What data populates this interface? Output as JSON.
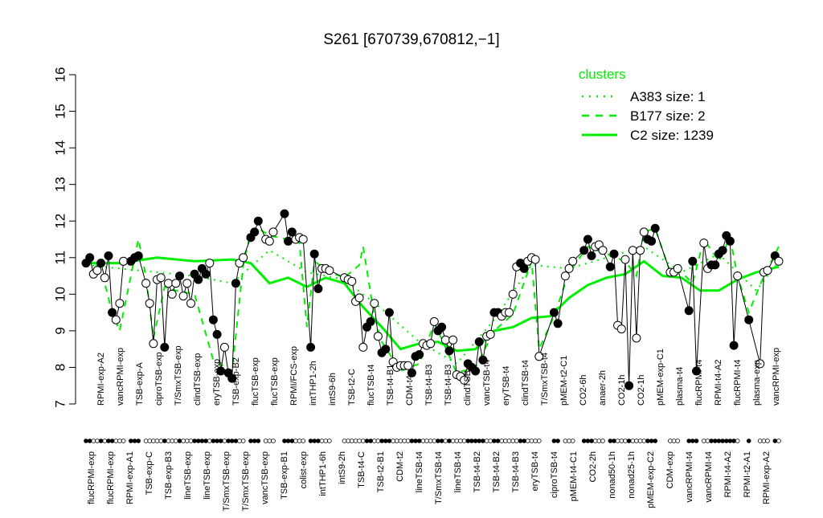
{
  "chart_data": {
    "type": "line",
    "title": "S261 [670739,670812,−1]",
    "xlabel": "",
    "ylabel": "",
    "ylim": [
      7,
      16
    ],
    "y_ticks": [
      "7",
      "8",
      "9",
      "10",
      "11",
      "12",
      "13",
      "14",
      "15",
      "16"
    ],
    "grid": false,
    "legend": {
      "title": "clusters",
      "placement": "top-right",
      "color": "#00ee00",
      "entries": [
        {
          "label": "A383 size: 1",
          "style": "dotted"
        },
        {
          "label": "B177 size: 2",
          "style": "dashed"
        },
        {
          "label": "C2 size: 1239",
          "style": "solid"
        }
      ]
    },
    "x_tick_labels": [
      "flucRPMI-exp",
      "RPMI-exp-A2",
      "flucRPMI-exp",
      "vancRPMI-exp",
      "RPMI-exp-A1",
      "TSB-exp-A",
      "TSB-exp-C",
      "ciproTSB-exp",
      "TSB-exp-B3",
      "T/SmxTSB-exp",
      "lineTSB-exp",
      "clindTSB-exp",
      "lineTSB-exp",
      "eryTSB-exp",
      "T/SmxTSB-exp",
      "TSB-exp-B2",
      "T/SmxTSB-exp",
      "flucTSB-exp",
      "vancTSB-exp",
      "flucTSB-exp",
      "TSB-exp-B1",
      "RPMI/FCS-exp",
      "colist-exp",
      "intTHP1-2h",
      "intTHP1-6h",
      "intS9-6h",
      "intS9-2h",
      "TSB-t2-C",
      "TSB-t4-C",
      "flucTSB-t4",
      "TSB-t2-B1",
      "TSB-t4-B1",
      "CDM-t2",
      "CDM-t4",
      "lineTSB-t4",
      "TSB-t4-B3",
      "T/SmxTSB-t4",
      "TSB-t4-B3",
      "lineTSB-t4",
      "clindTSB-t4",
      "TSB-t4-B2",
      "vancTSB-t4",
      "TSB-t4-B2",
      "eryTSB-t4",
      "TSB-t4-B3",
      "clindTSB-t4",
      "eryTSB-t4",
      "T/SmxTSB-t4",
      "ciproTSB-t4",
      "pMEM-t2-C1",
      "pMEM-t4-C1",
      "CO2-6h",
      "CO2-2h",
      "anaer-2h",
      "nonad50-1h",
      "CO2-1h",
      "nonad25-1h",
      "CO2-1h",
      "pMEM-exp-C2",
      "pMEM-exp-C1",
      "CDM-exp",
      "plasma-t4",
      "vancRPMI-t4",
      "flucRPMI-t4",
      "vancRPMI-t4",
      "RPMI-t4-A2",
      "RPMI-t4-A2",
      "flucRPMI-t4",
      "RPMI-t2-A1",
      "plasma-exp",
      "RPMI-exp-A2",
      "vancRPMI-exp"
    ],
    "series": [
      {
        "name": "",
        "style": "points-black-line",
        "points": [
          [
            1,
            10.85
          ],
          [
            2,
            11.0
          ],
          [
            3,
            10.55
          ],
          [
            4,
            10.65
          ],
          [
            5,
            10.85
          ],
          [
            6,
            10.45
          ],
          [
            7,
            11.05
          ],
          [
            8,
            9.5
          ],
          [
            9,
            9.3
          ],
          [
            10,
            9.75
          ],
          [
            11,
            10.9
          ],
          [
            13,
            10.9
          ],
          [
            14,
            11.0
          ],
          [
            15,
            11.05
          ],
          [
            17,
            10.3
          ],
          [
            18,
            9.75
          ],
          [
            19,
            8.65
          ],
          [
            20,
            10.4
          ],
          [
            21,
            10.45
          ],
          [
            22,
            8.55
          ],
          [
            23,
            10.3
          ],
          [
            24,
            10.0
          ],
          [
            25,
            10.3
          ],
          [
            26,
            10.5
          ],
          [
            27,
            9.95
          ],
          [
            28,
            10.3
          ],
          [
            29,
            9.75
          ],
          [
            30,
            10.55
          ],
          [
            31,
            10.4
          ],
          [
            32,
            10.7
          ],
          [
            33,
            10.55
          ],
          [
            34,
            10.85
          ],
          [
            35,
            9.3
          ],
          [
            36,
            8.9
          ],
          [
            37,
            7.9
          ],
          [
            38,
            8.55
          ],
          [
            39,
            7.85
          ],
          [
            40,
            7.7
          ],
          [
            41,
            10.3
          ],
          [
            42,
            10.85
          ],
          [
            43,
            11.0
          ],
          [
            45,
            11.55
          ],
          [
            46,
            11.7
          ],
          [
            47,
            12.0
          ],
          [
            49,
            11.5
          ],
          [
            50,
            11.45
          ],
          [
            51,
            11.7
          ],
          [
            54,
            12.2
          ],
          [
            55,
            11.45
          ],
          [
            56,
            11.7
          ],
          [
            57,
            11.5
          ],
          [
            58,
            11.55
          ],
          [
            59,
            11.5
          ],
          [
            61,
            8.55
          ],
          [
            62,
            11.1
          ],
          [
            63,
            10.15
          ],
          [
            64,
            10.7
          ],
          [
            65,
            10.7
          ],
          [
            66,
            10.65
          ],
          [
            70,
            10.45
          ],
          [
            71,
            10.4
          ],
          [
            72,
            10.35
          ],
          [
            73,
            9.8
          ],
          [
            74,
            9.9
          ],
          [
            75,
            8.55
          ],
          [
            76,
            9.1
          ],
          [
            77,
            9.25
          ],
          [
            78,
            9.75
          ],
          [
            79,
            8.85
          ],
          [
            80,
            8.4
          ],
          [
            81,
            8.5
          ],
          [
            82,
            9.5
          ],
          [
            83,
            8.15
          ],
          [
            84,
            8.0
          ],
          [
            85,
            8.05
          ],
          [
            86,
            8.05
          ],
          [
            87,
            8.05
          ],
          [
            88,
            7.85
          ],
          [
            89,
            8.3
          ],
          [
            90,
            8.35
          ],
          [
            91,
            8.65
          ],
          [
            92,
            8.6
          ],
          [
            93,
            8.65
          ],
          [
            94,
            9.25
          ],
          [
            95,
            9.0
          ],
          [
            96,
            9.1
          ],
          [
            97,
            8.75
          ],
          [
            98,
            8.45
          ],
          [
            99,
            8.75
          ],
          [
            100,
            7.8
          ],
          [
            101,
            7.75
          ],
          [
            102,
            7.65
          ],
          [
            103,
            8.1
          ],
          [
            104,
            8.0
          ],
          [
            105,
            7.9
          ],
          [
            106,
            8.7
          ],
          [
            107,
            8.2
          ],
          [
            108,
            8.85
          ],
          [
            109,
            8.9
          ],
          [
            110,
            9.5
          ],
          [
            111,
            9.5
          ],
          [
            112,
            9.4
          ],
          [
            113,
            9.5
          ],
          [
            114,
            9.5
          ],
          [
            115,
            10.0
          ],
          [
            116,
            10.75
          ],
          [
            117,
            10.85
          ],
          [
            118,
            10.7
          ],
          [
            119,
            10.9
          ],
          [
            120,
            11.0
          ],
          [
            121,
            10.95
          ],
          [
            122,
            8.3
          ],
          [
            126,
            9.5
          ],
          [
            127,
            9.2
          ],
          [
            129,
            10.5
          ],
          [
            130,
            10.7
          ],
          [
            131,
            10.9
          ],
          [
            134,
            11.2
          ],
          [
            135,
            11.5
          ],
          [
            136,
            11.05
          ],
          [
            137,
            11.3
          ],
          [
            138,
            11.35
          ],
          [
            139,
            11.2
          ],
          [
            141,
            10.75
          ],
          [
            142,
            11.1
          ],
          [
            143,
            9.15
          ],
          [
            144,
            9.05
          ],
          [
            145,
            10.95
          ],
          [
            146,
            7.5
          ],
          [
            147,
            11.2
          ],
          [
            148,
            8.8
          ],
          [
            149,
            11.2
          ],
          [
            150,
            11.7
          ],
          [
            151,
            11.5
          ],
          [
            152,
            11.45
          ],
          [
            153,
            11.8
          ],
          [
            157,
            10.6
          ],
          [
            158,
            10.6
          ],
          [
            159,
            10.7
          ],
          [
            162,
            9.55
          ],
          [
            163,
            10.9
          ],
          [
            164,
            7.9
          ],
          [
            166,
            11.4
          ],
          [
            167,
            10.7
          ],
          [
            168,
            10.8
          ],
          [
            169,
            10.8
          ],
          [
            170,
            11.1
          ],
          [
            171,
            11.2
          ],
          [
            172,
            11.6
          ],
          [
            173,
            11.45
          ],
          [
            174,
            8.6
          ],
          [
            175,
            10.5
          ],
          [
            178,
            9.3
          ],
          [
            181,
            8.1
          ],
          [
            182,
            10.6
          ],
          [
            183,
            10.65
          ],
          [
            185,
            11.05
          ],
          [
            186,
            10.9
          ]
        ]
      },
      {
        "name": "C2 size: 1239",
        "style": "solid",
        "x": [
          1,
          10,
          20,
          30,
          40,
          45,
          50,
          55,
          60,
          65,
          70,
          75,
          80,
          85,
          90,
          95,
          100,
          105,
          110,
          115,
          120,
          125,
          130,
          135,
          140,
          145,
          150,
          155,
          160,
          165,
          170,
          175,
          180,
          186
        ],
        "values": [
          10.85,
          10.85,
          11.0,
          10.9,
          10.95,
          10.85,
          10.3,
          10.45,
          10.2,
          10.45,
          10.3,
          9.65,
          9.1,
          8.5,
          8.65,
          8.7,
          8.45,
          8.5,
          9.0,
          9.1,
          9.35,
          9.4,
          9.9,
          10.25,
          10.45,
          10.55,
          10.9,
          10.5,
          10.45,
          10.1,
          10.1,
          10.4,
          10.6,
          10.75
        ]
      },
      {
        "name": "B177 size: 2",
        "style": "dashed",
        "x": [
          1,
          5,
          8,
          10,
          15,
          17,
          19,
          22,
          25,
          30,
          35,
          40,
          43,
          45,
          47,
          50,
          55,
          58,
          60,
          62,
          66,
          70,
          74,
          75,
          78,
          80,
          85,
          90,
          94,
          95,
          100,
          105,
          110,
          115,
          120,
          122,
          126,
          130,
          135,
          140,
          145,
          148,
          150,
          153,
          157,
          160,
          163,
          166,
          170,
          173,
          175,
          178,
          182,
          186
        ],
        "values": [
          11.0,
          10.7,
          9.5,
          9.0,
          11.5,
          10.5,
          8.8,
          10.2,
          10.1,
          10.0,
          8.2,
          7.9,
          10.8,
          11.7,
          11.8,
          11.6,
          11.5,
          11.4,
          9.1,
          10.9,
          10.6,
          10.45,
          10.8,
          11.3,
          9.4,
          8.7,
          7.9,
          8.1,
          9.2,
          9.0,
          7.85,
          8.0,
          9.0,
          9.45,
          10.9,
          8.5,
          9.4,
          10.6,
          11.3,
          11.1,
          10.9,
          10.5,
          11.7,
          11.8,
          10.6,
          10.6,
          10.3,
          11.5,
          10.9,
          11.55,
          10.5,
          9.5,
          10.5,
          11.3
        ]
      },
      {
        "name": "A383 size: 1",
        "style": "dotted",
        "x": [
          1,
          10,
          20,
          30,
          40,
          50,
          60,
          70,
          80,
          90,
          100,
          110,
          120,
          130,
          140,
          150,
          160,
          170,
          180,
          186
        ],
        "values": [
          10.8,
          10.7,
          10.6,
          10.5,
          10.3,
          11.2,
          10.6,
          10.4,
          9.6,
          8.7,
          8.1,
          9.3,
          10.8,
          10.7,
          11.0,
          11.3,
          10.6,
          11.1,
          10.1,
          10.9
        ]
      }
    ],
    "group_markers": "1:b,2:b,3:w,4:w,5:b,6:w,7:b,8:b,9:w,10:w,11:w,13:b,14:b,15:b,17:w,18:w,19:w,20:w,21:w,22:b,23:w,24:w,25:w,26:b,27:w,28:w,29:w,30:b,31:b,32:b,33:b,34:w,35:b,36:b,37:b,38:w,39:b,40:b,41:b,42:w,43:w,45:b,46:b,47:b,49:w,50:w,51:w,54:b,55:b,56:b,57:w,58:w,59:w,61:b,62:b,63:b,64:w,65:w,66:w,70:w,71:w,72:w,73:w,74:w,75:w,76:b,77:b,78:w,79:w,80:b,81:b,82:b,83:w,84:w,85:w,86:w,87:w,88:b,89:b,90:b,91:w,92:w,93:w,94:w,95:b,96:b,97:w,98:b,99:w,100:w,101:w,102:w,103:b,104:b,105:b,106:b,107:b,108:w,109:w,110:b,111:b,112:w,113:w,114:w,115:w,116:w,117:b,118:b,119:w,120:w,121:w,122:w,126:b,127:b,129:w,130:w,131:w,134:b,135:b,136:b,137:w,138:w,139:w,141:b,142:b,143:w,144:w,145:w,146:b,147:w,148:w,149:w,150:w,151:b,152:b,153:b,157:w,158:w,159:w,162:b,163:b,164:b,166:w,167:w,168:b,169:b,170:b,171:b,172:b,173:b,174:b,175:w,178:b,181:w,182:w,183:w,185:b,186:w"
  }
}
